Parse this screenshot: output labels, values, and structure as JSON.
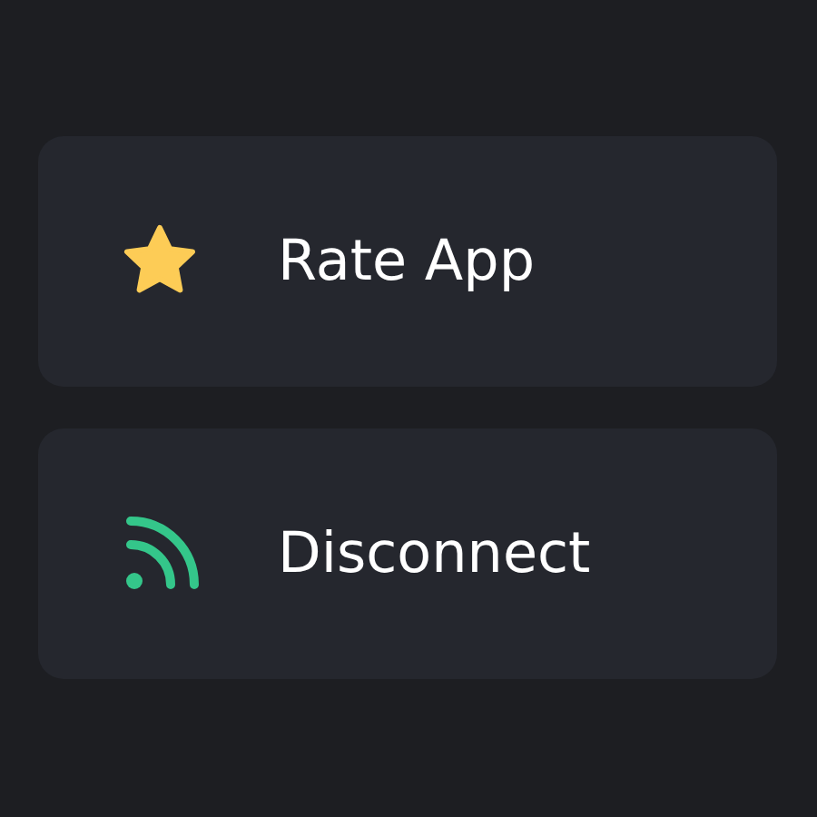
{
  "menu": [
    {
      "kind": "star",
      "label": "Rate App"
    },
    {
      "kind": "signal",
      "label": "Disconnect"
    }
  ]
}
